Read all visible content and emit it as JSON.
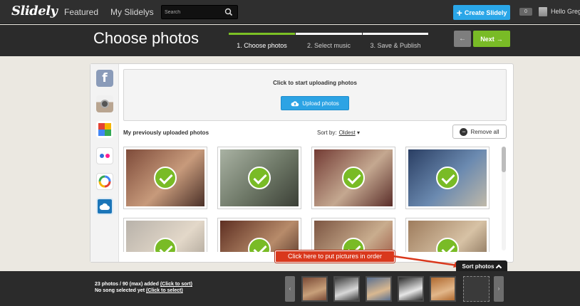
{
  "nav": {
    "logo": "Slidely",
    "featured": "Featured",
    "my_slidelys": "My Slidelys",
    "search_placeholder": "Search",
    "create_label": "Create Slidely",
    "notifications": "0",
    "hello": "Hello Greg"
  },
  "header": {
    "title": "Choose photos",
    "steps": [
      {
        "label": "1. Choose photos",
        "active": true
      },
      {
        "label": "2. Select music",
        "active": false
      },
      {
        "label": "3. Save & Publish",
        "active": false
      }
    ],
    "back_label": "←",
    "next_label": "Next",
    "next_arrow": "→"
  },
  "sources": [
    "facebook-icon",
    "instagram-icon",
    "picasa-icon",
    "flickr-icon",
    "google-photos-icon",
    "cloud-upload-icon"
  ],
  "upload": {
    "prompt": "Click to start uploading photos",
    "button_label": "Upload photos"
  },
  "photos": {
    "section_label": "My previously uploaded photos",
    "sort_label": "Sort by:",
    "sort_value": "Oldest",
    "sort_caret": "▾",
    "remove_all": "Remove all",
    "items": [
      {
        "selected": true,
        "colors": [
          "#7e4b3a",
          "#c79a7b",
          "#4a3028"
        ]
      },
      {
        "selected": true,
        "colors": [
          "#a9b2a3",
          "#6c7665",
          "#3b3f36"
        ]
      },
      {
        "selected": true,
        "colors": [
          "#733b34",
          "#c4a890",
          "#5a2d29"
        ]
      },
      {
        "selected": true,
        "colors": [
          "#2a3e63",
          "#6b8ab0",
          "#c0b9a9"
        ]
      },
      {
        "selected": true,
        "colors": [
          "#b8b2aa",
          "#e3d8c9",
          "#9c9489"
        ]
      },
      {
        "selected": true,
        "colors": [
          "#5e2f22",
          "#b78b6a",
          "#3c2018"
        ]
      },
      {
        "selected": true,
        "colors": [
          "#7c5542",
          "#c9ad8e",
          "#8f3d2c"
        ]
      },
      {
        "selected": true,
        "colors": [
          "#9e7c5d",
          "#d7c2a5",
          "#6c553f"
        ]
      }
    ]
  },
  "callout": "Click here to put pictures in order",
  "sort_tab": "Sort photos",
  "bottom": {
    "count_text": "23 photos / 90 (max) added",
    "sort_link": "(Click to sort)",
    "song_text": "No song selected yet",
    "select_link": "(Click to select)",
    "prev_arrow": "‹",
    "next_arrow": "›",
    "strip": [
      {
        "colors": [
          "#7a4a36",
          "#c8a07a"
        ]
      },
      {
        "colors": [
          "#3a3a3a",
          "#d8d8d8"
        ]
      },
      {
        "colors": [
          "#5a7090",
          "#d9b890"
        ]
      },
      {
        "colors": [
          "#2a2a2a",
          "#e6e6e6"
        ]
      },
      {
        "colors": [
          "#b06a30",
          "#e2b78a"
        ]
      }
    ]
  },
  "colors": {
    "accent_green": "#79bb26",
    "accent_blue": "#2aa6e8",
    "callout_red": "#d9381c"
  }
}
